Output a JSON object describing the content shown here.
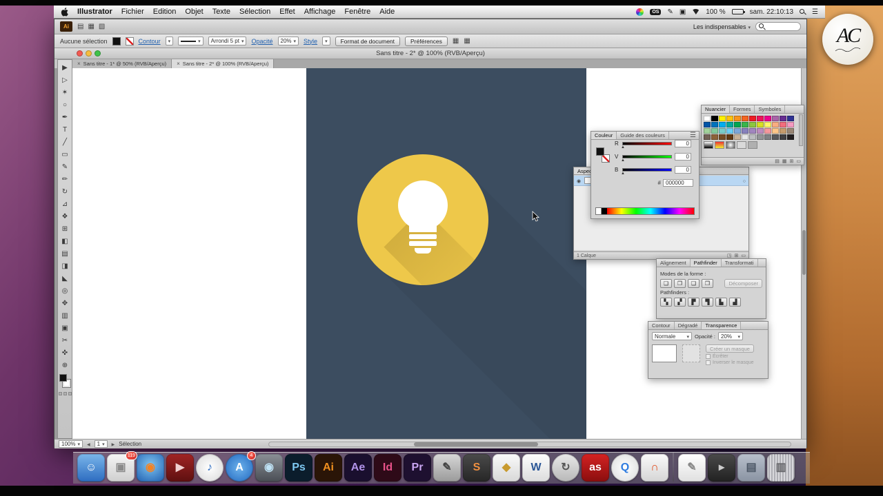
{
  "watermark": {
    "initials": "AC"
  },
  "menubar": {
    "app_name": "Illustrator",
    "menus": [
      "Fichier",
      "Edition",
      "Objet",
      "Texte",
      "Sélection",
      "Effet",
      "Affichage",
      "Fenêtre",
      "Aide"
    ],
    "os_badge": "OS",
    "battery_text": "100 %",
    "clock": "sam. 22:10:13"
  },
  "app_bar": {
    "logo_text": "Ai",
    "workspace": "Les indispensables",
    "bar_icons": [
      {
        "name": "new-document-icon",
        "glyph": "▤"
      },
      {
        "name": "grid-view-icon",
        "glyph": "▦"
      },
      {
        "name": "arrange-documents-icon",
        "glyph": "▧"
      }
    ]
  },
  "control_bar": {
    "selection_label": "Aucune sélection",
    "contour": "Contour",
    "brush": "Arrondi 5 pt",
    "opacity_label": "Opacité",
    "opacity_value": "20%",
    "style_label": "Style",
    "doc_format": "Format de document",
    "preferences": "Préférences"
  },
  "document": {
    "title": "Sans titre - 2* @ 100% (RVB/Aperçu)",
    "tabs": [
      {
        "label": "Sans titre - 1* @ 50% (RVB/Aperçu)",
        "active": false
      },
      {
        "label": "Sans titre - 2* @ 100% (RVB/Aperçu)",
        "active": true
      }
    ],
    "zoom": "100%",
    "artboard": "1",
    "tool_status": "Sélection"
  },
  "tools": [
    {
      "name": "selection-tool",
      "glyph": "▶"
    },
    {
      "name": "direct-selection-tool",
      "glyph": "▷"
    },
    {
      "name": "magic-wand-tool",
      "glyph": "✶"
    },
    {
      "name": "lasso-tool",
      "glyph": "○"
    },
    {
      "name": "pen-tool",
      "glyph": "✒"
    },
    {
      "name": "type-tool",
      "glyph": "T"
    },
    {
      "name": "line-segment-tool",
      "glyph": "╱"
    },
    {
      "name": "rectangle-tool",
      "glyph": "▭"
    },
    {
      "name": "paintbrush-tool",
      "glyph": "✎"
    },
    {
      "name": "pencil-tool",
      "glyph": "✏"
    },
    {
      "name": "rotate-tool",
      "glyph": "↻"
    },
    {
      "name": "scale-tool",
      "glyph": "⊿"
    },
    {
      "name": "width-tool",
      "glyph": "❖"
    },
    {
      "name": "free-transform-tool",
      "glyph": "⊞"
    },
    {
      "name": "shape-builder-tool",
      "glyph": "◧"
    },
    {
      "name": "mesh-tool",
      "glyph": "▤"
    },
    {
      "name": "gradient-tool",
      "glyph": "◨"
    },
    {
      "name": "eyedropper-tool",
      "glyph": "◣"
    },
    {
      "name": "blend-tool",
      "glyph": "◎"
    },
    {
      "name": "symbol-sprayer-tool",
      "glyph": "✥"
    },
    {
      "name": "column-graph-tool",
      "glyph": "▥"
    },
    {
      "name": "artboard-tool",
      "glyph": "▣"
    },
    {
      "name": "slice-tool",
      "glyph": "✂"
    },
    {
      "name": "hand-tool",
      "glyph": "✜"
    },
    {
      "name": "zoom-tool",
      "glyph": "⊕"
    }
  ],
  "panels": {
    "nuancier": {
      "tabs": [
        {
          "label": "Nuancier",
          "active": true
        },
        {
          "label": "Formes",
          "active": false
        },
        {
          "label": "Symboles",
          "active": false
        }
      ],
      "swatches": [
        "#ffffff",
        "#000000",
        "#fff100",
        "#ffc20e",
        "#f7941d",
        "#f26522",
        "#ed1c24",
        "#ed145b",
        "#ec008c",
        "#a864a8",
        "#662d91",
        "#2e3192",
        "#0054a6",
        "#0072bc",
        "#00aeef",
        "#00a99d",
        "#00a651",
        "#39b54a",
        "#8dc63f",
        "#d7df23",
        "#fff568",
        "#f9ad81",
        "#f26d7d",
        "#f49ac1",
        "#a3d39c",
        "#82ca9c",
        "#7accc8",
        "#6dcff6",
        "#7da7d9",
        "#8781bd",
        "#a186be",
        "#bd8cbf",
        "#f5989d",
        "#fdc689",
        "#c69c6d",
        "#998675",
        "#736357",
        "#8c6239",
        "#754c24",
        "#603913",
        "#c7b299",
        "#e6e7e8",
        "#bcbec0",
        "#939598",
        "#808285",
        "#58595b",
        "#414042",
        "#231f20"
      ],
      "patterns": [
        "linear-gradient(180deg,#ffffff,#000000)",
        "linear-gradient(180deg,#ee3333,#eeee33)",
        "radial-gradient(circle,#ffffff,#555555)",
        "#d9d9d9",
        "#b0b0b0"
      ],
      "footer_icons": [
        {
          "name": "swatch-libraries-icon",
          "glyph": "▤"
        },
        {
          "name": "swatch-kinds-icon",
          "glyph": "▦"
        },
        {
          "name": "new-swatch-icon",
          "glyph": "⊞"
        },
        {
          "name": "delete-swatch-icon",
          "glyph": "▭"
        }
      ]
    },
    "couleur": {
      "tabs": [
        {
          "label": "Couleur",
          "active": true
        },
        {
          "label": "Guide des couleurs",
          "active": false
        }
      ],
      "channels": [
        {
          "label": "R",
          "value": "0",
          "track": "linear-gradient(90deg,#000000,#ff0000)"
        },
        {
          "label": "V",
          "value": "0",
          "track": "linear-gradient(90deg,#000000,#00ff00)"
        },
        {
          "label": "B",
          "value": "0",
          "track": "linear-gradient(90deg,#000000,#0000ff)"
        }
      ],
      "hex_label": "#",
      "hex_value": "000000"
    },
    "calques": {
      "tab": "Aspect",
      "count": "1 Calque",
      "footer_icons": [
        {
          "name": "new-layer-group-icon",
          "glyph": "◳"
        },
        {
          "name": "new-layer-icon",
          "glyph": "⊞"
        },
        {
          "name": "delete-layer-icon",
          "glyph": "▭"
        }
      ]
    },
    "pathfinder": {
      "tabs": [
        {
          "label": "Alignement",
          "active": false
        },
        {
          "label": "Pathfinder",
          "active": true
        },
        {
          "label": "Transformati",
          "active": false
        }
      ],
      "shape_modes_label": "Modes de la forme :",
      "shape_modes": [
        {
          "name": "unite-button",
          "glyph": "❏"
        },
        {
          "name": "minus-front-button",
          "glyph": "❐"
        },
        {
          "name": "intersect-button",
          "glyph": "❑"
        },
        {
          "name": "exclude-button",
          "glyph": "❒"
        }
      ],
      "decompose": "Décomposer",
      "pathfinders_label": "Pathfinders :",
      "pathfinder_buttons": [
        {
          "name": "divide-button",
          "glyph": "▚"
        },
        {
          "name": "trim-button",
          "glyph": "▞"
        },
        {
          "name": "merge-button",
          "glyph": "▛"
        },
        {
          "name": "crop-button",
          "glyph": "▜"
        },
        {
          "name": "outline-button",
          "glyph": "▙"
        },
        {
          "name": "minus-back-button",
          "glyph": "▟"
        }
      ]
    },
    "transparence": {
      "tabs": [
        {
          "label": "Contour",
          "active": false
        },
        {
          "label": "Dégradé",
          "active": false
        },
        {
          "label": "Transparence",
          "active": true
        }
      ],
      "blend_mode": "Normale",
      "opacity_label": "Opacité :",
      "opacity_value": "20%",
      "make_mask": "Créer un masque",
      "clip": "Écrêter",
      "invert": "Inverser le masque"
    }
  },
  "artwork": {
    "background": "#3c4d60",
    "circle": "#eec84a"
  },
  "dock": {
    "apps": [
      {
        "name": "dock-finder",
        "glyph": "☺",
        "bg": "linear-gradient(180deg,#7ab6ea,#2d6cc0)",
        "fg": "#ffffff"
      },
      {
        "name": "dock-photos",
        "glyph": "▣",
        "bg": "linear-gradient(180deg,#f5f5f5,#cfcfcf)",
        "fg": "#8a8a8a",
        "badge": "119"
      },
      {
        "name": "dock-firefox",
        "glyph": "◉",
        "bg": "radial-gradient(circle at 50% 40%,#7fc4f0,#1f5fb0)",
        "fg": "#f58220"
      },
      {
        "name": "dock-red-app",
        "glyph": "▶",
        "bg": "linear-gradient(180deg,#a02424,#5e1010)",
        "fg": "#f0d0d0"
      },
      {
        "name": "dock-itunes",
        "glyph": "♪",
        "bg": "radial-gradient(circle,#ffffff,#d8d8d8)",
        "fg": "#2d6cc0",
        "shape": "circle"
      },
      {
        "name": "dock-app-store",
        "glyph": "A",
        "bg": "radial-gradient(circle,#6db2ec,#1f66be)",
        "fg": "#ffffff",
        "shape": "circle",
        "badge": "4"
      },
      {
        "name": "dock-photo-booth",
        "glyph": "◉",
        "bg": "linear-gradient(180deg,#8a8f96,#4a4e55)",
        "fg": "#bfe2f5"
      },
      {
        "name": "dock-photoshop",
        "glyph": "Ps",
        "bg": "#0b1d2c",
        "fg": "#7ec8f2"
      },
      {
        "name": "dock-illustrator",
        "glyph": "Ai",
        "bg": "#2a1507",
        "fg": "#ef8f1f"
      },
      {
        "name": "dock-after-effects",
        "glyph": "Ae",
        "bg": "#1a0f2e",
        "fg": "#b193e8"
      },
      {
        "name": "dock-indesign",
        "glyph": "Id",
        "bg": "#2e0a18",
        "fg": "#e8528a"
      },
      {
        "name": "dock-premiere",
        "glyph": "Pr",
        "bg": "#1e1030",
        "fg": "#c9a6f2"
      },
      {
        "name": "dock-tablet-app",
        "glyph": "✎",
        "bg": "linear-gradient(180deg,#d8d8d8,#9a9a9a)",
        "fg": "#444444"
      },
      {
        "name": "dock-sublime-text",
        "glyph": "S",
        "bg": "linear-gradient(180deg,#4a4a4a,#262626)",
        "fg": "#f09040"
      },
      {
        "name": "dock-sketch",
        "glyph": "◆",
        "bg": "linear-gradient(180deg,#fafafa,#d8d8d8)",
        "fg": "#c89a2e"
      },
      {
        "name": "dock-word",
        "glyph": "W",
        "bg": "linear-gradient(180deg,#fdfdfd,#dcdcdc)",
        "fg": "#2b5797"
      },
      {
        "name": "dock-sync-app",
        "glyph": "↻",
        "bg": "linear-gradient(180deg,#e8e8e8,#b8b8b8)",
        "fg": "#555555",
        "shape": "circle"
      },
      {
        "name": "dock-audioscrobbler",
        "glyph": "as",
        "bg": "linear-gradient(180deg,#d42222,#8a0e0e)",
        "fg": "#ffffff"
      },
      {
        "name": "dock-quicktime",
        "glyph": "Q",
        "bg": "radial-gradient(circle,#ffffff,#dadada)",
        "fg": "#2d7be0",
        "shape": "circle"
      },
      {
        "name": "dock-headphones-app",
        "glyph": "∩",
        "bg": "linear-gradient(180deg,#fafafa,#d5d5d5)",
        "fg": "#e04818"
      }
    ],
    "docs": [
      {
        "name": "dock-textedit",
        "glyph": "✎",
        "bg": "linear-gradient(180deg,#ffffff,#e0e0e0)",
        "fg": "#888888"
      },
      {
        "name": "dock-utility",
        "glyph": "▸",
        "bg": "linear-gradient(180deg,#4a4a4a,#222222)",
        "fg": "#cccccc"
      },
      {
        "name": "dock-downloads-stack",
        "glyph": "▤",
        "bg": "linear-gradient(180deg,#b8c0cc,#8a93a2)",
        "fg": "#4a5564"
      },
      {
        "name": "dock-trash",
        "glyph": "▥",
        "bg": "repeating-linear-gradient(90deg,#d8d8dc 0 2px,#aeaeb4 2px 4px)",
        "fg": "#66666a"
      }
    ]
  }
}
